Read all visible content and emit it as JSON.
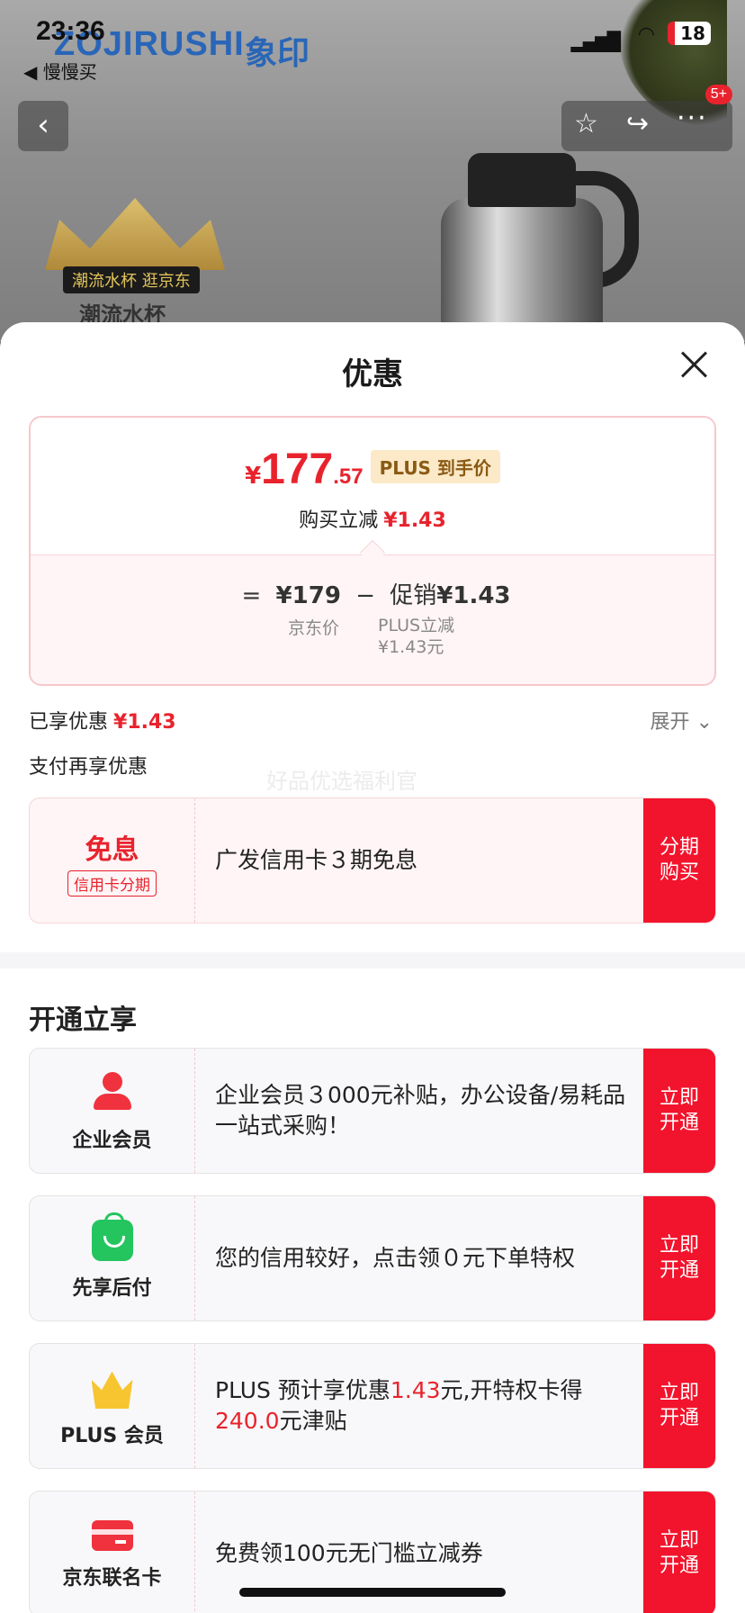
{
  "status_bar": {
    "time": "23:36",
    "battery": "18"
  },
  "back_app": "◀ 慢慢买",
  "background": {
    "brand_en": "ZOJIRUSHI",
    "brand_cn": "象印",
    "tag_small": "潮流水杯 逛京东",
    "tag_big": "潮流水杯"
  },
  "nav": {
    "more_badge": "5+"
  },
  "sheet": {
    "title": "优惠",
    "price": {
      "currency": "¥",
      "integer": "177",
      "decimal": ".57",
      "plus_tag": "PLUS 到手价",
      "reduce_label": "购买立减",
      "reduce_value": "¥1.43",
      "formula_eq": "=",
      "jd_price": "¥179",
      "minus": "−",
      "promo_label": "促销",
      "promo_value": "¥1.43",
      "jd_price_label": "京东价",
      "plus_reduce_label": "PLUS立减",
      "plus_reduce_value": "¥1.43元"
    },
    "enjoyed_label": "已享优惠",
    "enjoyed_value": "¥1.43",
    "expand_label": "展开",
    "pay_more_title": "支付再享优惠",
    "watermark": "好品优选福利官",
    "credit": {
      "title": "免息",
      "tag": "信用卡分期",
      "desc": "广发信用卡３期免息",
      "button": "分期购买"
    },
    "open_title": "开通立享",
    "rows": [
      {
        "label": "企业会员",
        "desc": " 企业会员３000元补贴，办公设备/易耗品一站式采购！",
        "button": "立即开通"
      },
      {
        "label": "先享后付",
        "desc": "您的信用较好，点击领０元下单特权",
        "button": "立即开通"
      },
      {
        "label": "PLUS 会员",
        "desc_a": "PLUS 预计享优惠",
        "desc_b": "1.43",
        "desc_c": "元,开特权卡得",
        "desc_d": "240.0",
        "desc_e": "元津贴",
        "button": "立即开通"
      },
      {
        "label": "京东联名卡",
        "desc": "免费领100元无门槛立减券",
        "button": "立即开通"
      }
    ]
  }
}
